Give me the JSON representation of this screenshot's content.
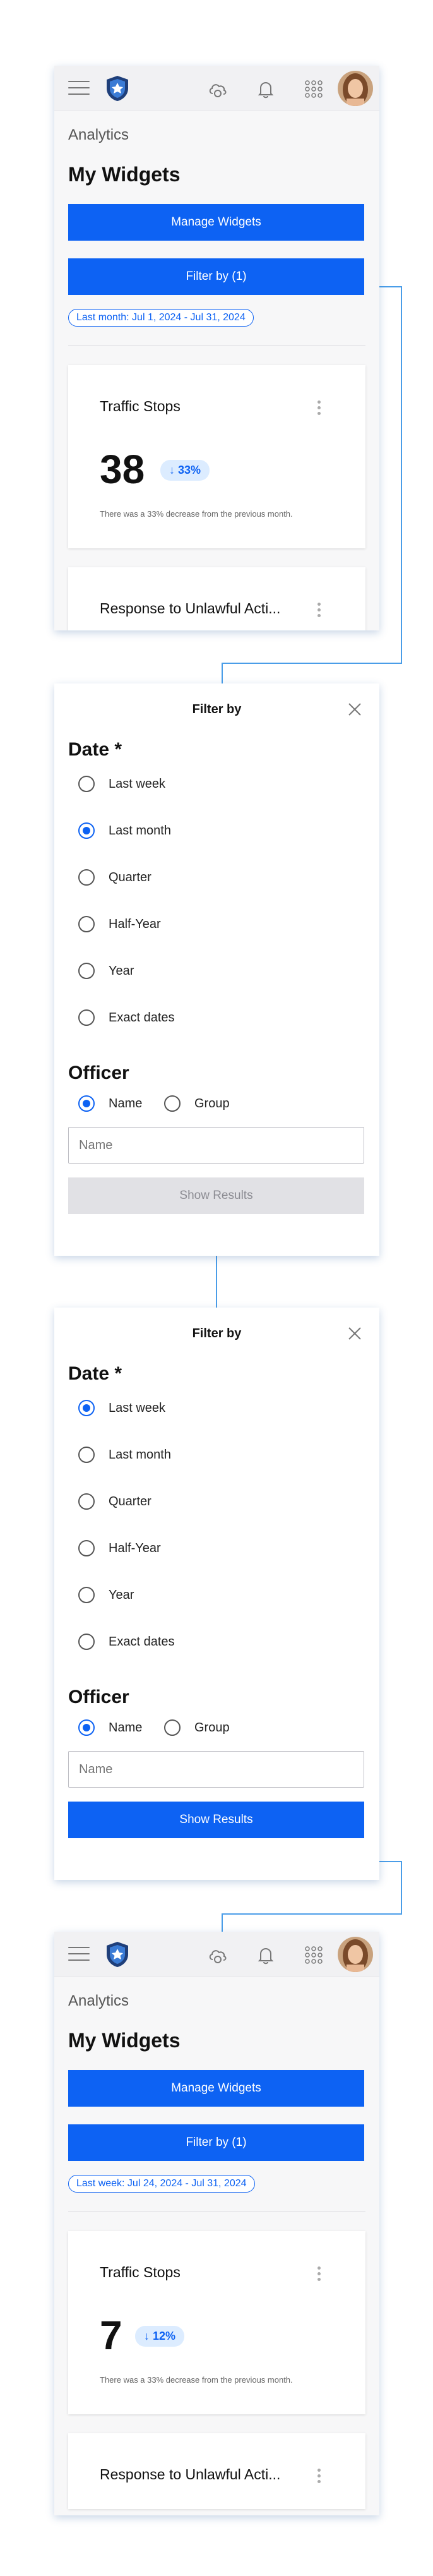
{
  "topbar": {
    "icons": [
      "menu-icon",
      "shield-logo",
      "cloud-sync-icon",
      "bell-icon",
      "apps-grid-icon",
      "user-avatar"
    ]
  },
  "screen1": {
    "section": "Analytics",
    "heading": "My Widgets",
    "manage_label": "Manage Widgets",
    "filter_label": "Filter by (1)",
    "chip": "Last month: Jul 1, 2024 - Jul 31, 2024",
    "card": {
      "title": "Traffic Stops",
      "value": "38",
      "change": "33%",
      "description": "There was a 33% decrease from the previous month."
    },
    "card2_title": "Response to Unlawful Acti..."
  },
  "filter_panel": {
    "title": "Filter by",
    "date_heading": "Date *",
    "date_options": [
      "Last week",
      "Last month",
      "Quarter",
      "Half-Year",
      "Year",
      "Exact dates"
    ],
    "officer_heading": "Officer",
    "officer_options": [
      "Name",
      "Group"
    ],
    "name_placeholder": "Name",
    "show_results": "Show Results"
  },
  "screen2_selected": "Last month",
  "screen3_selected": "Last week",
  "screen4": {
    "section": "Analytics",
    "heading": "My Widgets",
    "manage_label": "Manage Widgets",
    "filter_label": "Filter by (1)",
    "chip": "Last week: Jul 24, 2024 - Jul 31, 2024",
    "card": {
      "title": "Traffic Stops",
      "value": "7",
      "change": "12%",
      "description": "There was a 33% decrease from the previous month."
    },
    "card2_title": "Response to Unlawful Acti..."
  },
  "colors": {
    "accent": "#0d62f3",
    "connector": "#4a9de8"
  }
}
